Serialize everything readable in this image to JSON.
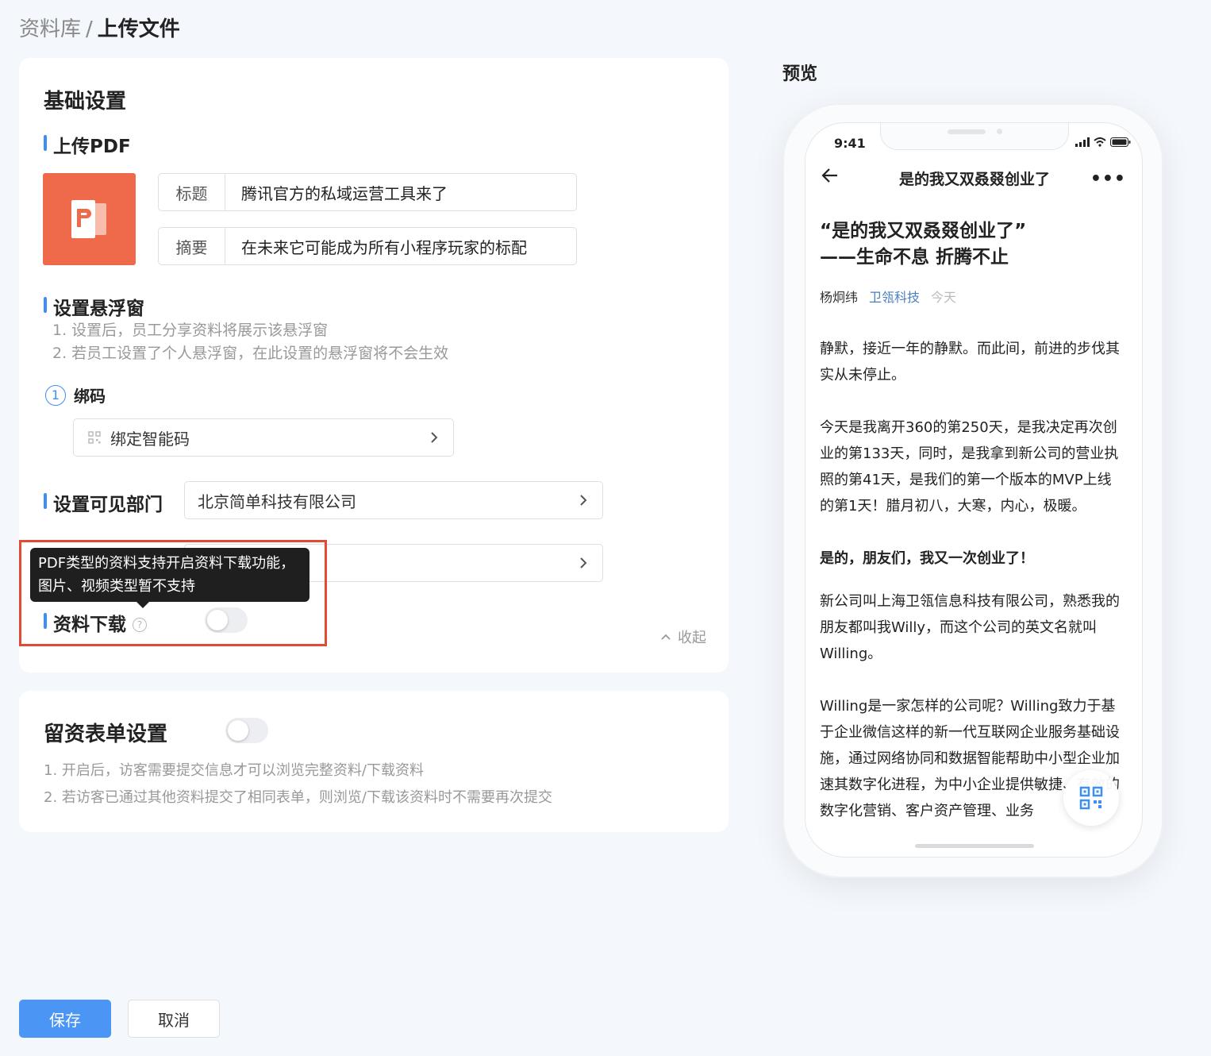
{
  "breadcrumb": {
    "root": "资料库",
    "separator": "/",
    "current": "上传文件"
  },
  "basic": {
    "title": "基础设置",
    "upload": {
      "section_title": "上传PDF",
      "file_icon": "pdf-file-icon",
      "fields": [
        {
          "label": "标题",
          "value": "腾讯官方的私域运营工具来了"
        },
        {
          "label": "摘要",
          "value": "在未来它可能成为所有小程序玩家的标配"
        }
      ]
    },
    "float_window": {
      "section_title": "设置悬浮窗",
      "hints": [
        "1. 设置后，员工分享资料将展示该悬浮窗",
        "2. 若员工设置了个人悬浮窗，在此设置的悬浮窗将不会生效"
      ],
      "step_number": "1",
      "step_label": "绑码",
      "bind_button": "绑定智能码"
    },
    "visible_dept": {
      "section_title": "设置可见部门",
      "value": "北京简单科技有限公司"
    },
    "download": {
      "section_title": "资料下载",
      "enabled": false,
      "tooltip_line1": "PDF类型的资料支持开启资料下载功能，",
      "tooltip_line2": "图片、视频类型暂不支持"
    },
    "collapse_label": "收起"
  },
  "lead_form": {
    "title": "留资表单设置",
    "enabled": false,
    "hints": [
      "1. 开启后，访客需要提交信息才可以浏览完整资料/下载资料",
      "2. 若访客已通过其他资料提交了相同表单，则浏览/下载该资料时不需要再次提交"
    ]
  },
  "actions": {
    "save": "保存",
    "cancel": "取消"
  },
  "preview": {
    "label": "预览",
    "status_time": "9:41",
    "nav_title": "是的我又双叒叕创业了",
    "nav_more": "•••",
    "article": {
      "title_line1": "“是的我又双叒叕创业了”",
      "title_line2": "——生命不息 折腾不止",
      "author": "杨炯纬",
      "org": "卫瓴科技",
      "date": "今天",
      "paragraphs": [
        "静默，接近一年的静默。而此间，前进的步伐其实从未停止。",
        "今天是我离开360的第250天，是我决定再次创业的第133天，同时，是我拿到新公司的营业执照的第41天，是我们的第一个版本的MVP上线的第1天！腊月初八，大寒，内心，极暖。",
        "是的，朋友们，我又一次创业了！",
        "新公司叫上海卫瓴信息科技有限公司，熟悉我的朋友都叫我Willy，而这个公司的英文名就叫Willing。",
        "Willing是一家怎样的公司呢？Willing致力于基于企业微信这样的新一代互联网企业服务基础设施，通过网络协同和数据智能帮助中小型企业加速其数字化进程，为中小企业提供敏捷、有效的数字化营销、客户资产管理、业务"
      ]
    }
  },
  "colors": {
    "accent": "#3d8ef5",
    "pdf": "#ef6a4a",
    "highlight": "#e14b36",
    "save": "#4b96f5"
  }
}
